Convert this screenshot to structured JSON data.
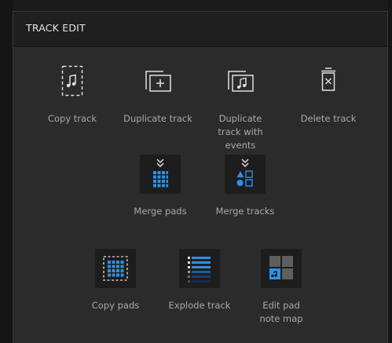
{
  "header": {
    "title": "TRACK EDIT"
  },
  "colors": {
    "accent": "#2e8fe8",
    "panel_bg": "#2b2b2b",
    "header_bg": "#1f1f1f",
    "tile_bg": "#1d1d1d",
    "text": "#a9a9a9",
    "title_text": "#e6e6e6"
  },
  "actions": [
    {
      "id": "copy_track",
      "label": "Copy track",
      "icon": "copy-track-icon"
    },
    {
      "id": "duplicate_track",
      "label": "Duplicate track",
      "icon": "duplicate-track-icon"
    },
    {
      "id": "duplicate_track_events",
      "label": "Duplicate track with events",
      "icon": "duplicate-track-with-events-icon"
    },
    {
      "id": "delete_track",
      "label": "Delete track",
      "icon": "delete-track-icon"
    },
    {
      "id": "merge_pads",
      "label": "Merge pads",
      "icon": "merge-pads-icon"
    },
    {
      "id": "merge_tracks",
      "label": "Merge tracks",
      "icon": "merge-tracks-icon"
    },
    {
      "id": "copy_pads",
      "label": "Copy pads",
      "icon": "copy-pads-icon"
    },
    {
      "id": "explode_track",
      "label": "Explode track",
      "icon": "explode-track-icon"
    },
    {
      "id": "edit_pad_note_map",
      "label": "Edit pad note map",
      "icon": "edit-pad-note-map-icon"
    }
  ]
}
